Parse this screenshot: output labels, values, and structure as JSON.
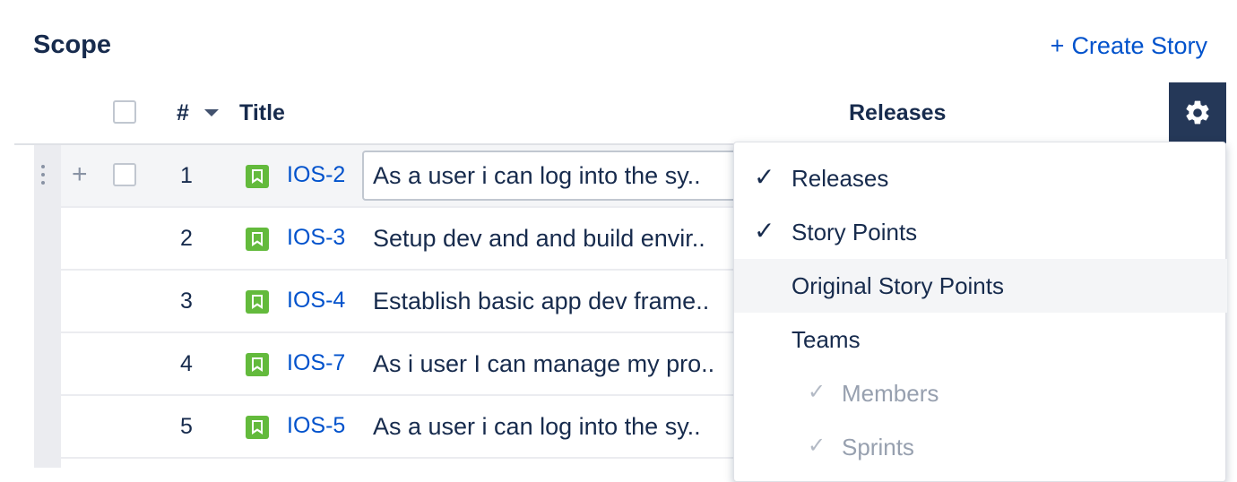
{
  "header": {
    "title": "Scope",
    "create_story_plus": "+",
    "create_story_label": "Create Story"
  },
  "table": {
    "columns": {
      "num": "#",
      "title": "Title",
      "releases": "Releases"
    },
    "rows": [
      {
        "num": "1",
        "key": "IOS-2",
        "title": "As a user i can log into the sy.."
      },
      {
        "num": "2",
        "key": "IOS-3",
        "title": "Setup dev and and build envir.."
      },
      {
        "num": "3",
        "key": "IOS-4",
        "title": "Establish basic app dev frame.."
      },
      {
        "num": "4",
        "key": "IOS-7",
        "title": "As i user I can manage my pro.."
      },
      {
        "num": "5",
        "key": "IOS-5",
        "title": "As a user i can log into the sy.."
      }
    ],
    "row_plus": "+"
  },
  "menu": {
    "check_glyph": "✓",
    "items": [
      {
        "label": "Releases",
        "checked": true
      },
      {
        "label": "Story Points",
        "checked": true
      },
      {
        "label": "Original Story Points",
        "checked": false
      },
      {
        "label": "Teams",
        "checked": false
      },
      {
        "label": "Members",
        "checked": true,
        "sub": true
      },
      {
        "label": "Sprints",
        "checked": true,
        "sub": true
      }
    ]
  },
  "colors": {
    "accent": "#0052cc",
    "story_icon": "#63ba3c",
    "gear_bg": "#253858"
  },
  "icons": {
    "gear": "gear-icon",
    "story": "story-icon",
    "sort": "caret-down-icon"
  }
}
